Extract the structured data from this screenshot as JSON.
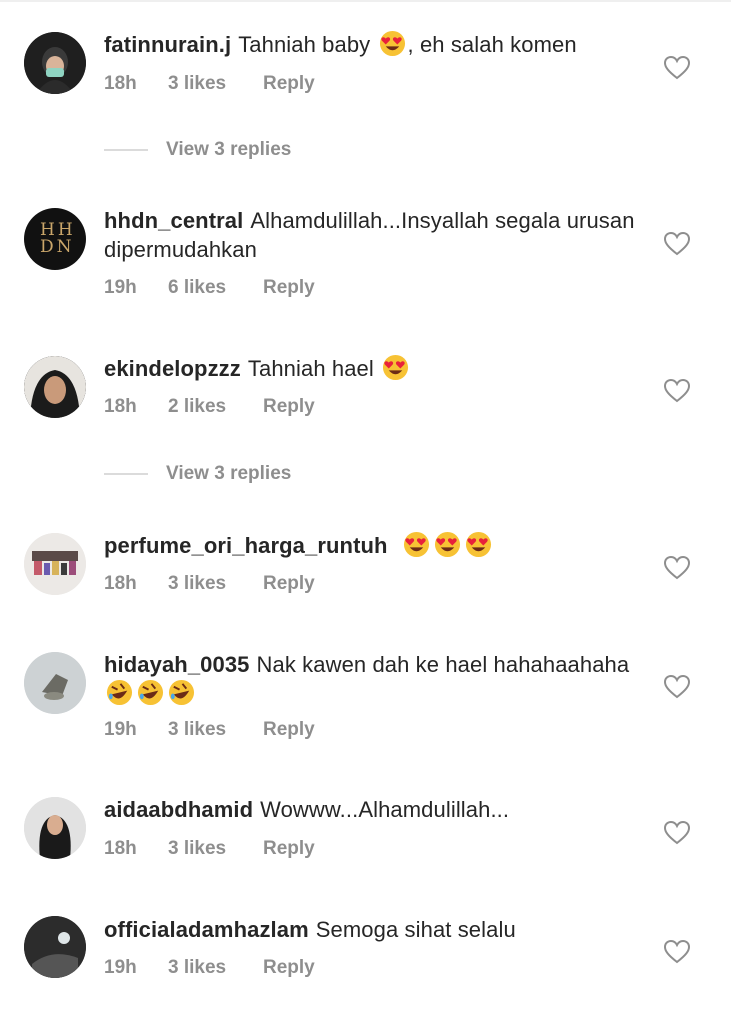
{
  "comments": [
    {
      "username": "fatinnurain.j",
      "text_before": "Tahniah baby",
      "emoji_count": 1,
      "emoji": "heart-eyes",
      "text_after": ", eh salah komen",
      "time": "18h",
      "likes": "3 likes",
      "reply": "Reply"
    },
    {
      "username": "hhdn_central",
      "text_before": "Alhamdulillah...Insyallah segala urusan dipermudahkan",
      "time": "19h",
      "likes": "6 likes",
      "reply": "Reply"
    },
    {
      "username": "ekindelopzzz",
      "text_before": "Tahniah hael",
      "emoji_count": 1,
      "emoji": "heart-eyes",
      "time": "18h",
      "likes": "2 likes",
      "reply": "Reply"
    },
    {
      "username": "perfume_ori_harga_runtuh",
      "text_before": "",
      "emoji_count": 3,
      "emoji": "heart-eyes",
      "time": "18h",
      "likes": "3 likes",
      "reply": "Reply"
    },
    {
      "username": "hidayah_0035",
      "text_before": "Nak kawen dah ke hael hahahaahaha",
      "emoji_count": 3,
      "emoji": "rofl",
      "time": "19h",
      "likes": "3 likes",
      "reply": "Reply"
    },
    {
      "username": "aidaabdhamid",
      "text_before": "Wowww...Alhamdulillah...",
      "time": "18h",
      "likes": "3 likes",
      "reply": "Reply"
    },
    {
      "username": "officialadamhazlam",
      "text_before": "Semoga sihat selalu",
      "time": "19h",
      "likes": "3 likes",
      "reply": "Reply"
    }
  ],
  "view_replies": [
    "View 3 replies",
    "View 3 replies"
  ],
  "avatar_hhdn_text": [
    "HH",
    "DN"
  ],
  "colors": {
    "text": "#262626",
    "meta": "#8e8e8e",
    "divider": "#dbdbdb"
  }
}
